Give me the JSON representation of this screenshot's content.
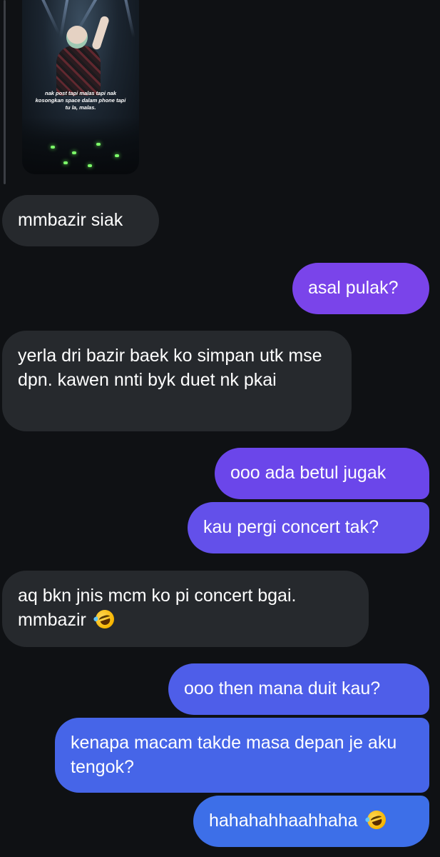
{
  "media": {
    "overlay_caption": "nak post tapi malas tapi nak kosongkan space dalam phone tapi tu la, malas."
  },
  "messages": [
    {
      "id": "m1",
      "direction": "received",
      "text": "mmbazir siak"
    },
    {
      "id": "m2",
      "direction": "sent",
      "text": "asal pulak?"
    },
    {
      "id": "m3",
      "direction": "received",
      "text": "yerla dri bazir baek ko simpan utk mse dpn. kawen nnti byk duet nk pkai"
    },
    {
      "id": "m4",
      "direction": "sent",
      "text": "ooo ada betul jugak"
    },
    {
      "id": "m5",
      "direction": "sent",
      "text": "kau pergi concert tak?"
    },
    {
      "id": "m6",
      "direction": "received",
      "text": "aq bkn jnis mcm ko pi concert bgai. mmbazir",
      "emoji": "rolling-on-floor-laughing-emoji"
    },
    {
      "id": "m7",
      "direction": "sent",
      "text": "ooo then mana duit kau?"
    },
    {
      "id": "m8",
      "direction": "sent",
      "text": "kenapa macam takde masa depan je aku tengok?"
    },
    {
      "id": "m9",
      "direction": "sent",
      "text": "hahahahhaahhaha",
      "emoji": "rolling-on-floor-laughing-emoji"
    }
  ],
  "colors": {
    "background": "#0f1114",
    "received_bubble": "#26292d",
    "sent_gradient_top": "#7a44ea",
    "sent_gradient_bottom": "#3d6fe8"
  }
}
